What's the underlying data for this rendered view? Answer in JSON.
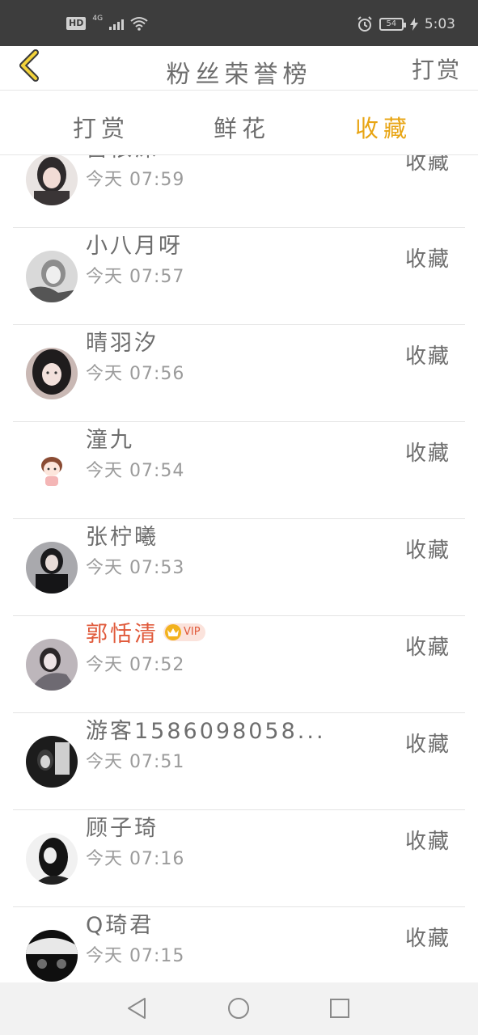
{
  "status_bar": {
    "hd": "HD",
    "network": "4G",
    "battery": "54",
    "time": "5:03",
    "icons": [
      "signal-icon",
      "wifi-icon",
      "alarm-icon",
      "charging-icon"
    ]
  },
  "header": {
    "title": "粉丝荣誉榜",
    "action": "打赏",
    "back_icon": "chevron-left-icon"
  },
  "tabs": [
    {
      "label": "打赏",
      "active": false
    },
    {
      "label": "鲜花",
      "active": false
    },
    {
      "label": "收藏",
      "active": true
    }
  ],
  "rows": [
    {
      "name": "宫依沫",
      "time": "今天 07:59",
      "action": "收藏",
      "vip": false
    },
    {
      "name": "小八月呀",
      "time": "今天 07:57",
      "action": "收藏",
      "vip": false
    },
    {
      "name": "晴羽汐",
      "time": "今天 07:56",
      "action": "收藏",
      "vip": false
    },
    {
      "name": "潼九",
      "time": "今天 07:54",
      "action": "收藏",
      "vip": false
    },
    {
      "name": "张柠曦",
      "time": "今天 07:53",
      "action": "收藏",
      "vip": false
    },
    {
      "name": "郭恬清",
      "time": "今天 07:52",
      "action": "收藏",
      "vip": true,
      "vip_label": "VIP"
    },
    {
      "name": "游客1586098058...",
      "time": "今天 07:51",
      "action": "收藏",
      "vip": false
    },
    {
      "name": "顾子琦",
      "time": "今天 07:16",
      "action": "收藏",
      "vip": false
    },
    {
      "name": "Q琦君",
      "time": "今天 07:15",
      "action": "收藏",
      "vip": false
    }
  ],
  "colors": {
    "accent": "#e8a514",
    "vip_name": "#e0593a",
    "status_bar": "#3d3d3d"
  },
  "nav_bar": [
    "back-triangle-icon",
    "home-circle-icon",
    "recents-square-icon"
  ]
}
